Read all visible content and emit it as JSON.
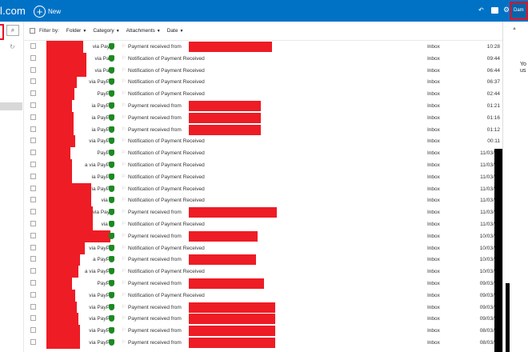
{
  "header": {
    "brand": "l.com",
    "new_label": "New",
    "user_label": "Dam",
    "colors": {
      "bar": "#0072c6",
      "accent_red": "#e81123"
    },
    "icons": [
      "undo-icon",
      "chat-icon",
      "gear-icon"
    ]
  },
  "sidebar": {
    "search_icon": "search-icon",
    "refresh_icon": "refresh-icon"
  },
  "filter": {
    "label": "Filter by:",
    "dropdowns": [
      "Folder",
      "Category",
      "Attachments",
      "Date"
    ]
  },
  "right_pane": {
    "text_line1": "Yo",
    "text_line2": "us"
  },
  "emails": [
    {
      "sender": "via Pay...",
      "subject": "Payment received from",
      "folder": "Inbox",
      "date": "10:28"
    },
    {
      "sender": "via Pa...",
      "subject": "Notification of Payment Received",
      "folder": "Inbox",
      "date": "09:44"
    },
    {
      "sender": "via Pa...",
      "subject": "Notification of Payment Received",
      "folder": "Inbox",
      "date": "06:44"
    },
    {
      "sender": "via PayPal",
      "subject": "Notification of Payment Received",
      "folder": "Inbox",
      "date": "06:37"
    },
    {
      "sender": "PayPal",
      "subject": "Notification of Payment Received",
      "folder": "Inbox",
      "date": "02:44"
    },
    {
      "sender": "ia PayPal",
      "subject": "Payment received from",
      "folder": "Inbox",
      "date": "01:21"
    },
    {
      "sender": "ia PayPal",
      "subject": "Payment received from",
      "folder": "Inbox",
      "date": "01:16"
    },
    {
      "sender": "ia PayPal",
      "subject": "Payment received from",
      "folder": "Inbox",
      "date": "01:12"
    },
    {
      "sender": "via PayPal",
      "subject": "Notification of Payment Received",
      "folder": "Inbox",
      "date": "00:11"
    },
    {
      "sender": "PayPal",
      "subject": "Notification of Payment Received",
      "folder": "Inbox",
      "date": "11/03/20"
    },
    {
      "sender": "a via PayPal",
      "subject": "Notification of Payment Received",
      "folder": "Inbox",
      "date": "11/03/20"
    },
    {
      "sender": "ia PayPal",
      "subject": "Notification of Payment Received",
      "folder": "Inbox",
      "date": "11/03/20"
    },
    {
      "sender": "via PayPal",
      "subject": "Notification of Payment Received",
      "folder": "Inbox",
      "date": "11/03/20"
    },
    {
      "sender": "via ...",
      "subject": "Notification of Payment Received",
      "folder": "Inbox",
      "date": "11/03/20"
    },
    {
      "sender": "via Pay...",
      "subject": "Payment received from",
      "folder": "Inbox",
      "date": "11/03/20"
    },
    {
      "sender": "via ...",
      "subject": "Notification of Payment Received",
      "folder": "Inbox",
      "date": "11/03/20"
    },
    {
      "sender": "",
      "subject": "Payment received from",
      "folder": "Inbox",
      "date": "10/03/20"
    },
    {
      "sender": "via PayPal",
      "subject": "Notification of Payment Received",
      "folder": "Inbox",
      "date": "10/03/20"
    },
    {
      "sender": "a PayPal",
      "subject": "Payment received from",
      "folder": "Inbox",
      "date": "10/03/20"
    },
    {
      "sender": "a via PayPal",
      "subject": "Notification of Payment Received",
      "folder": "Inbox",
      "date": "10/03/20"
    },
    {
      "sender": "PayPal",
      "subject": "Payment received from",
      "folder": "Inbox",
      "date": "09/03/20"
    },
    {
      "sender": "via PayPal",
      "subject": "Notification of Payment Received",
      "folder": "Inbox",
      "date": "09/03/20"
    },
    {
      "sender": "via PayPal",
      "subject": "Payment received from",
      "folder": "Inbox",
      "date": "09/03/20"
    },
    {
      "sender": "via PayPal",
      "subject": "Payment received from",
      "folder": "Inbox",
      "date": "09/03/20"
    },
    {
      "sender": "via PayPal",
      "subject": "Payment received from",
      "folder": "Inbox",
      "date": "08/03/20"
    },
    {
      "sender": "via PayPal",
      "subject": "Payment received from",
      "folder": "Inbox",
      "date": "08/03/20"
    }
  ]
}
